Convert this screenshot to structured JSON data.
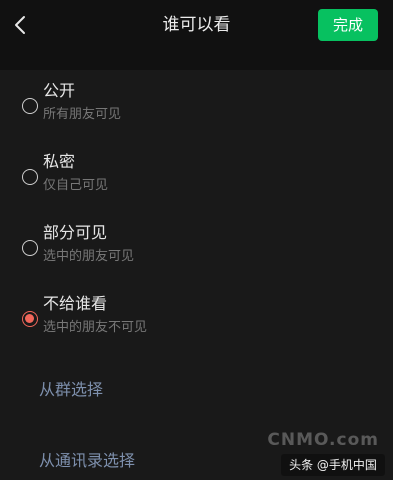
{
  "header": {
    "title": "谁可以看",
    "done_label": "完成",
    "back_icon": "chevron-left-icon"
  },
  "options": [
    {
      "title": "公开",
      "subtitle": "所有朋友可见",
      "checked": false
    },
    {
      "title": "私密",
      "subtitle": "仅自己可见",
      "checked": false
    },
    {
      "title": "部分可见",
      "subtitle": "选中的朋友可见",
      "checked": false
    },
    {
      "title": "不给谁看",
      "subtitle": "选中的朋友不可见",
      "checked": true
    }
  ],
  "links": {
    "from_group": "从群选择",
    "from_contacts": "从通讯录选择"
  },
  "watermark": {
    "logo": "CNMO.com",
    "text": "头条 @手机中国"
  },
  "colors": {
    "accent_green": "#07c160",
    "radio_selected": "#f0665a",
    "link": "#7d8fac"
  }
}
